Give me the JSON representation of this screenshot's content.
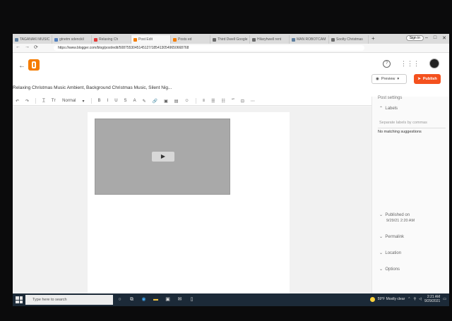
{
  "browser": {
    "tabs": [
      {
        "label": "TAGANAKI MUSIC",
        "color": "#5f7f9f"
      },
      {
        "label": "gtnetm sdenckil",
        "color": "#4f7fbf"
      },
      {
        "label": "Relaxing Ch",
        "color": "#e53935"
      },
      {
        "label": "Post Edit",
        "color": "#f57c00",
        "active": true
      },
      {
        "label": "Posts ed",
        "color": "#f57c00"
      },
      {
        "label": "Third Dwell Google",
        "color": "#6a6a6a"
      },
      {
        "label": "Hilaryhwell rent",
        "color": "#6a6a6a"
      },
      {
        "label": "MAN ROBOTCAM",
        "color": "#5f7f9f"
      },
      {
        "label": "Soolty Christmas",
        "color": "#6a6a6a"
      }
    ],
    "new_tab": "+",
    "signin": "Sign in",
    "controls": [
      "–",
      "□",
      "✕"
    ],
    "url": "https://www.blogger.com/blog/post/edit/5087553045145127/1854130549650668768",
    "nav": [
      "←",
      "→",
      "⟳"
    ]
  },
  "header": {
    "back": "←",
    "help": "?",
    "apps": "⋮⋮⋮"
  },
  "post": {
    "title": "Relaxing Christmas Music Ambient, Background Christmas Music, Silent Nig...",
    "preview_label": "Preview",
    "publish_label": "Publish"
  },
  "toolbar": {
    "items": [
      "↶",
      "↷",
      "T̲",
      "Tт",
      "Normal",
      "▾",
      "B",
      "I",
      "U",
      "S",
      "A",
      "✎",
      "🔗",
      "▣",
      "▤",
      "☺",
      "≡",
      "☰",
      "☷",
      "“”",
      "⊡",
      "⋯"
    ]
  },
  "editor": {
    "play": "▶"
  },
  "sidebar": {
    "title": "Post settings",
    "labels": "Labels",
    "labels_placeholder": "Separate labels by commas",
    "no_match": "No matching suggestions",
    "published_on": "Published on",
    "published_date": "9/29/21 2:20 AM",
    "permalink": "Permalink",
    "location": "Location",
    "options": "Options"
  },
  "taskbar": {
    "search_placeholder": "Type here to search",
    "weather": "59°F  Mostly clear",
    "time": "2:21 AM",
    "date": "9/29/2021"
  }
}
